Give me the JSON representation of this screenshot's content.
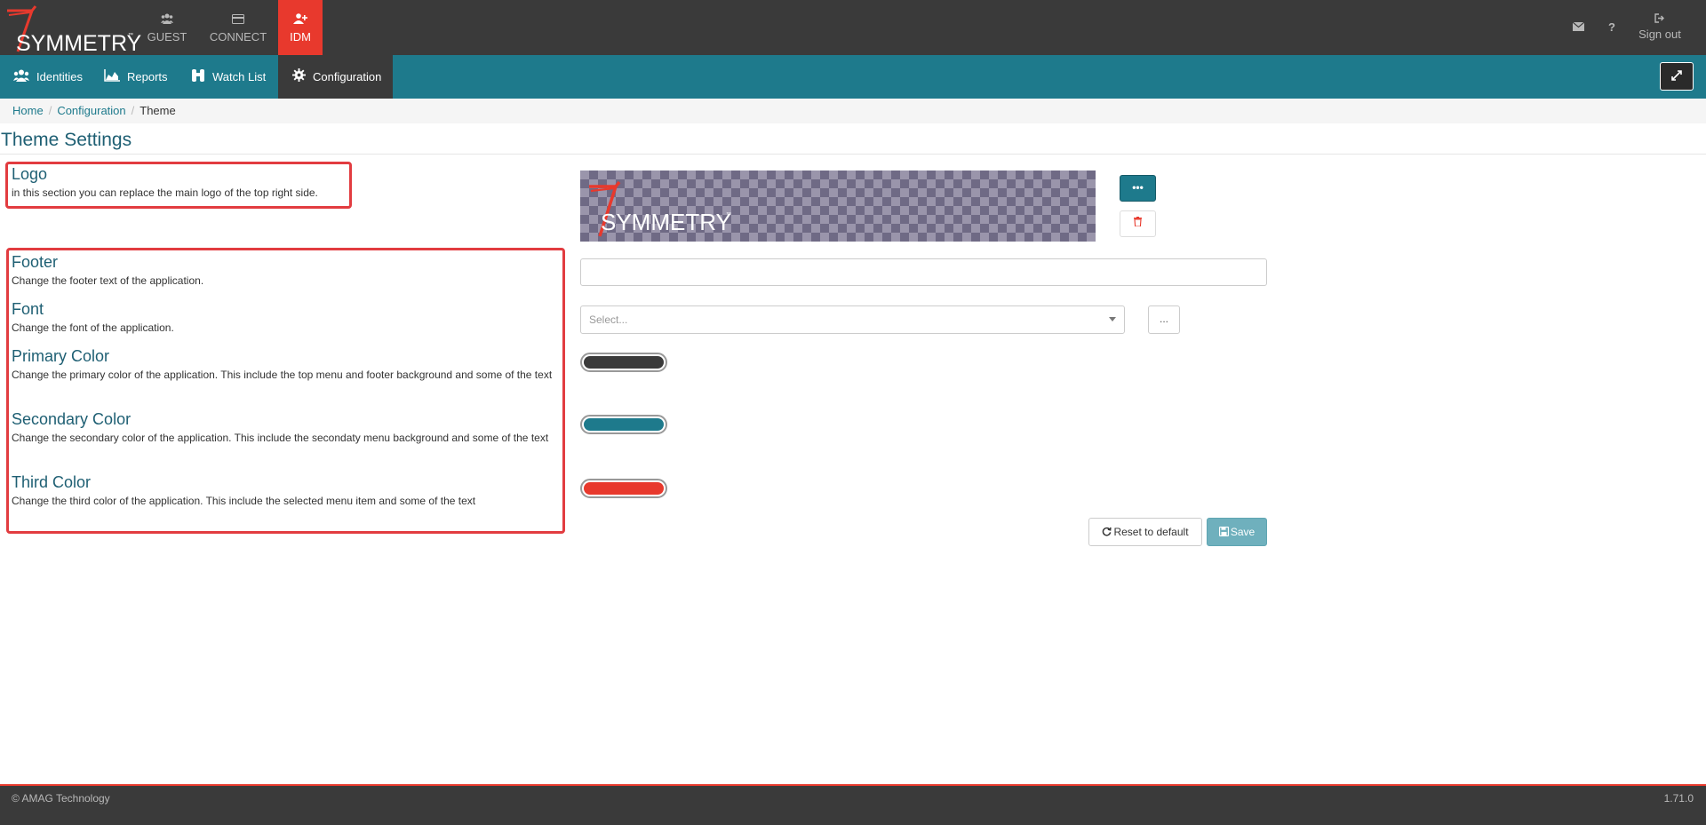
{
  "app": {
    "brand": "SYMMETRY",
    "brand_tm": "™"
  },
  "topnav": {
    "guest": {
      "label": "GUEST",
      "icon": "users-icon"
    },
    "connect": {
      "label": "CONNECT",
      "icon": "card-icon"
    },
    "idm": {
      "label": "IDM",
      "icon": "user-plus-icon"
    },
    "help_glyph": "?",
    "sign_out": "Sign out"
  },
  "subnav": {
    "identities": "Identities",
    "reports": "Reports",
    "watch_list": "Watch List",
    "configuration": "Configuration"
  },
  "breadcrumb": {
    "home": "Home",
    "configuration": "Configuration",
    "current": "Theme",
    "separator": "/"
  },
  "page": {
    "title": "Theme Settings"
  },
  "sections": {
    "logo": {
      "title": "Logo",
      "desc": "in this section you can replace the main logo of the top right side."
    },
    "footer": {
      "title": "Footer",
      "desc": "Change the footer text of the application.",
      "value": ""
    },
    "font": {
      "title": "Font",
      "desc": "Change the font of the application.",
      "placeholder": "Select...",
      "more_label": "..."
    },
    "primary_color": {
      "title": "Primary Color",
      "desc": "Change the primary color of the application. This include the top menu and footer background and some of the text",
      "color": "#3a3a3a"
    },
    "secondary_color": {
      "title": "Secondary Color",
      "desc": "Change the secondary color of the application. This include the secondaty menu background and some of the text",
      "color": "#1e7a8c"
    },
    "third_color": {
      "title": "Third Color",
      "desc": "Change the third color of the application. This include the selected menu item and some of the text",
      "color": "#e8392d"
    }
  },
  "logo_preview": {
    "text": "SYMMETRY",
    "tm": "™"
  },
  "buttons": {
    "more": "•••",
    "reset": "Reset to default",
    "save": "Save"
  },
  "footer": {
    "copyright": "© AMAG Technology",
    "version": "1.71.0"
  }
}
